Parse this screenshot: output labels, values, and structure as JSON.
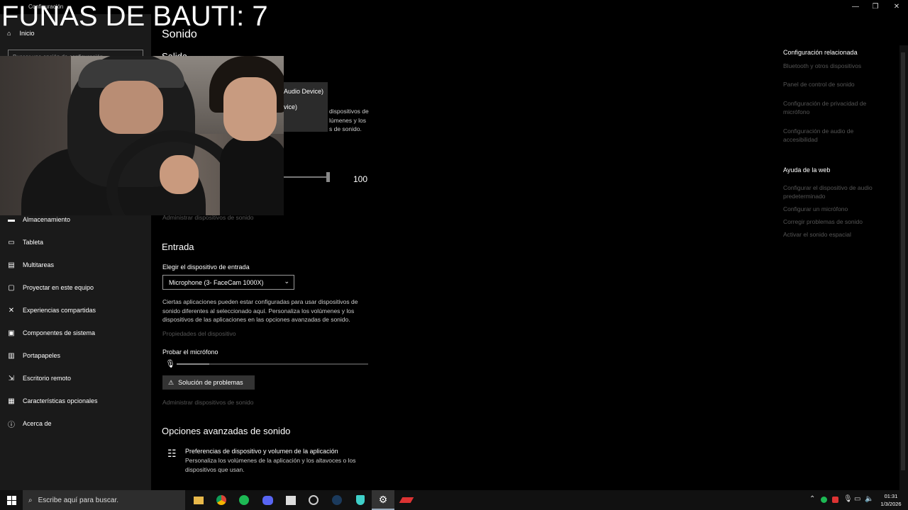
{
  "window": {
    "title": "Configuración",
    "minimize": "—",
    "restore": "❐",
    "close": "✕"
  },
  "overlay": {
    "title": "FUNAS DE BAUTI: 7"
  },
  "sidebar": {
    "home": "Inicio",
    "search_placeholder": "Buscar una opción de configuración",
    "items": [
      {
        "label": "Almacenamiento",
        "icon": "storage-icon"
      },
      {
        "label": "Tableta",
        "icon": "tablet-icon"
      },
      {
        "label": "Multitareas",
        "icon": "multitask-icon"
      },
      {
        "label": "Proyectar en este equipo",
        "icon": "project-icon"
      },
      {
        "label": "Experiencias compartidas",
        "icon": "shared-icon"
      },
      {
        "label": "Componentes de sistema",
        "icon": "components-icon"
      },
      {
        "label": "Portapapeles",
        "icon": "clipboard-icon"
      },
      {
        "label": "Escritorio remoto",
        "icon": "remote-icon"
      },
      {
        "label": "Características opcionales",
        "icon": "optional-icon"
      },
      {
        "label": "Acerca de",
        "icon": "info-icon"
      }
    ]
  },
  "main": {
    "title": "Sonido",
    "output_heading": "Salida",
    "output_device_1": "Audio Device)",
    "output_device_2": "vice)",
    "output_desc": "dispositivos de\nlúmenes y los\ns de sonido.",
    "volume_value": "100",
    "volume_level": 1.0,
    "manage_output": "Administrar dispositivos de sonido",
    "input_heading": "Entrada",
    "input_choose_label": "Elegir el dispositivo de entrada",
    "input_device": "Microphone (3- FaceCam 1000X)",
    "input_desc": "Ciertas aplicaciones pueden estar configuradas para usar dispositivos de sonido diferentes al seleccionado aquí. Personaliza los volúmenes y los dispositivos de las aplicaciones en las opciones avanzadas de sonido.",
    "device_properties": "Propiedades del dispositivo",
    "test_mic_label": "Probar el micrófono",
    "mic_level": 0.17,
    "troubleshoot": "Solución de problemas",
    "manage_input": "Administrar dispositivos de sonido",
    "advanced_heading": "Opciones avanzadas de sonido",
    "advanced_item_title": "Preferencias de dispositivo y volumen de la aplicación",
    "advanced_item_desc": "Personaliza los volúmenes de la aplicación y los altavoces o los dispositivos que usan."
  },
  "related": {
    "heading": "Configuración relacionada",
    "links": [
      "Bluetooth y otros dispositivos",
      "Panel de control de sonido",
      "Configuración de privacidad de micrófono",
      "Configuración de audio de accesibilidad"
    ]
  },
  "help": {
    "heading": "Ayuda de la web",
    "links": [
      "Configurar el dispositivo de audio predeterminado",
      "Configurar un micrófono",
      "Corregir problemas de sonido",
      "Activar el sonido espacial"
    ]
  },
  "taskbar": {
    "search_placeholder": "Escribe aquí para buscar.",
    "time": "01:31",
    "date": "1/3/2026"
  },
  "colors": {
    "accent": "#1a1a1a",
    "muted_link": "#555555"
  }
}
